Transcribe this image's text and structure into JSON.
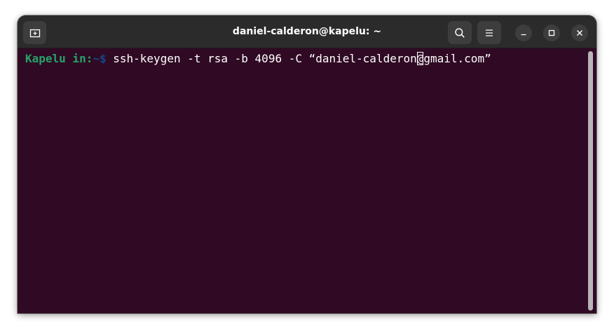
{
  "window": {
    "title": "daniel-calderon@kapelu: ~"
  },
  "titlebar": {
    "new_tab_icon": "new-tab-icon",
    "search_icon": "search-icon",
    "menu_icon": "hamburger-menu-icon",
    "minimize_icon": "minimize-icon",
    "maximize_icon": "maximize-icon",
    "close_icon": "close-icon"
  },
  "terminal": {
    "prompt_user": "Kapelu in",
    "prompt_colon": ":",
    "prompt_dir": "~",
    "prompt_symbol": "$",
    "command_before_cursor": " ssh-keygen -t rsa -b 4096 -C “daniel-calderon",
    "cursor_char": "@",
    "command_after_cursor": "gmail.com”"
  },
  "colors": {
    "terminal_bg": "#300a24",
    "titlebar_bg": "#2b2b2b",
    "prompt_user": "#26a269",
    "prompt_dir": "#12488b",
    "text": "#ffffff"
  }
}
